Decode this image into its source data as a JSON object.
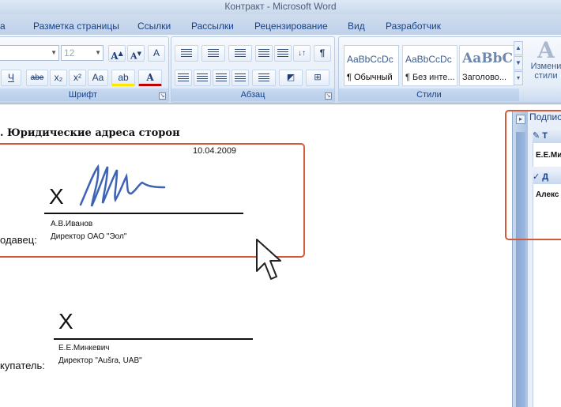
{
  "window": {
    "title": "Контракт - Microsoft Word"
  },
  "tabs": [
    {
      "label": "а"
    },
    {
      "label": "Разметка страницы"
    },
    {
      "label": "Ссылки"
    },
    {
      "label": "Рассылки"
    },
    {
      "label": "Рецензирование"
    },
    {
      "label": "Вид"
    },
    {
      "label": "Разработчик"
    }
  ],
  "ribbon": {
    "font_group": {
      "label": "Шрифт",
      "font_size": "12",
      "grow_label": "A",
      "shrink_label": "A",
      "clear_label": "A",
      "underline_label": "Ч",
      "strike_label": "abe",
      "sub_label": "x₂",
      "sup_label": "x²",
      "case_label": "Aa",
      "highlight_label": "ab",
      "color_label": "A"
    },
    "paragraph_group": {
      "label": "Абзац",
      "pilcrow": "¶"
    },
    "styles_group": {
      "label": "Стили",
      "styles": [
        {
          "preview": "AaBbCcDc",
          "name": "¶ Обычный"
        },
        {
          "preview": "AaBbCcDc",
          "name": "¶ Без инте..."
        },
        {
          "preview": "AaBbC",
          "name": "Заголово..."
        }
      ],
      "change_styles_label": "Измени стили"
    }
  },
  "document": {
    "heading": ". Юридические адреса сторон",
    "date": "10.04.2009",
    "seller": {
      "x_mark": "X",
      "name": "А.В.Иванов",
      "position": "Директор ОАО \"Эол\"",
      "role_label": "одавец:"
    },
    "buyer": {
      "x_mark": "X",
      "name": "Е.Е.Минкевич",
      "position": "Директор \"Aušra, UAB\"",
      "role_label": "купатель:"
    }
  },
  "signature_pane": {
    "title": "Подпис",
    "section1_header": "Т",
    "section1_item": "Е.Е.Ми",
    "section2_header": "Д",
    "section2_item": "Алекс"
  },
  "colors": {
    "highlight": "#d25a3a",
    "accent": "#15428b"
  }
}
